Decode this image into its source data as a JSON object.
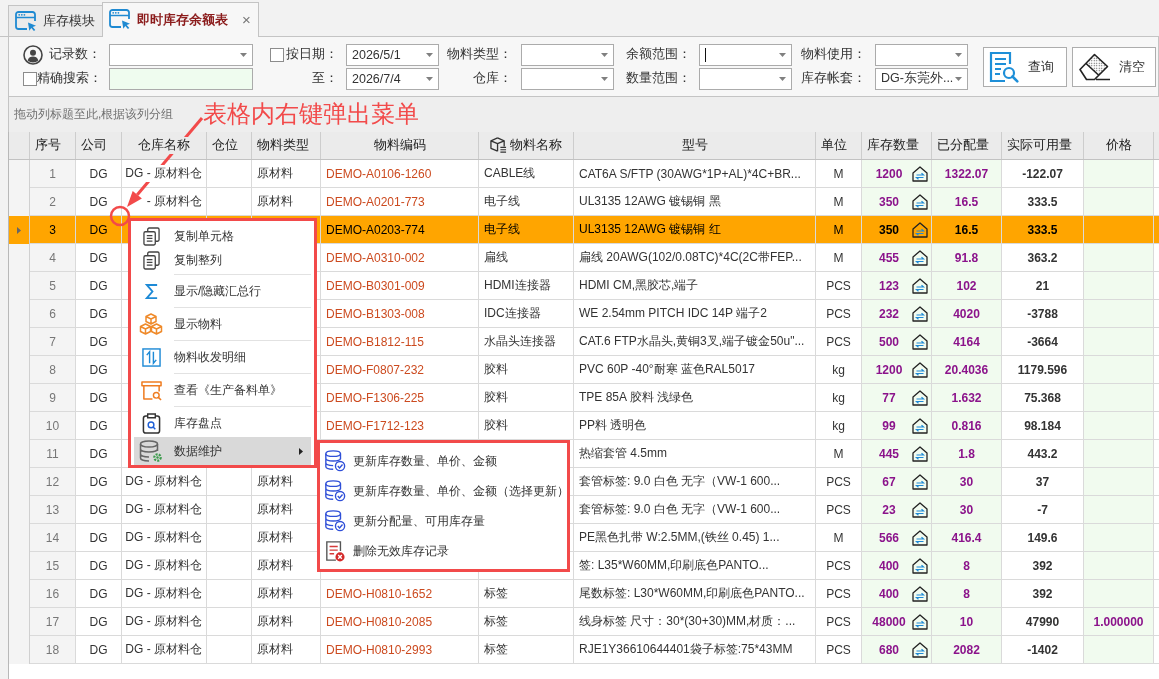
{
  "tabs": [
    {
      "label": "库存模块",
      "selected": false
    },
    {
      "label": "即时库存余额表",
      "selected": true,
      "close": "×"
    }
  ],
  "filters": {
    "record_count": {
      "label": "记录数："
    },
    "exact_search": {
      "label": "精确搜索：",
      "checked": false
    },
    "by_date": {
      "label": "按日期：",
      "checked": false,
      "value": "2026/5/1"
    },
    "date_to": {
      "label": "至：",
      "value": "2026/7/4"
    },
    "material_type": {
      "label": "物料类型："
    },
    "warehouse": {
      "label": "仓库："
    },
    "amount_range": {
      "label": "余额范围：",
      "focused": true
    },
    "quantity_range": {
      "label": "数量范围："
    },
    "material_usage": {
      "label": "物料使用："
    },
    "account_set": {
      "label": "库存帐套：",
      "value": "DG-东莞外..."
    }
  },
  "buttons": [
    {
      "label": "查询"
    },
    {
      "label": "清空"
    }
  ],
  "group_panel": {
    "hint": "拖动列标题至此,根据该列分组"
  },
  "annotation": {
    "text": "表格内右键弹出菜单"
  },
  "table": {
    "columns": [
      {
        "label": "序号"
      },
      {
        "label": "公司"
      },
      {
        "label": "仓库名称"
      },
      {
        "label": "仓位"
      },
      {
        "label": "物料类型"
      },
      {
        "label": "物料编码"
      },
      {
        "label": "物料名称"
      },
      {
        "label": "型号"
      },
      {
        "label": "单位"
      },
      {
        "label": "库存数量"
      },
      {
        "label": "已分配量"
      },
      {
        "label": "实际可用量"
      },
      {
        "label": "价格"
      }
    ],
    "rows": [
      {
        "no": "1",
        "company": "DG",
        "warehouse": "DG - 原材料仓",
        "material_type": "原材料",
        "code": "DEMO-A0106-1260",
        "name": "CABLE线",
        "model": "CAT6A S/FTP (30AWG*1P+AL)*4C+BR...",
        "unit": "M",
        "stock_qty": "1200",
        "allocated": "1322.07",
        "available": "-122.07",
        "selected": false
      },
      {
        "no": "2",
        "company": "DG",
        "warehouse": "- 原材料仓",
        "material_type": "原材料",
        "code": "DEMO-A0201-773",
        "name": "电子线",
        "model": "UL3135 12AWG 镀锡铜 黑",
        "unit": "M",
        "stock_qty": "350",
        "allocated": "16.5",
        "available": "333.5",
        "selected": false
      },
      {
        "no": "3",
        "company": "DG",
        "code": "DEMO-A0203-774",
        "name": "电子线",
        "model": "UL3135 12AWG 镀锡铜 红",
        "unit": "M",
        "stock_qty": "350",
        "allocated": "16.5",
        "available": "333.5",
        "selected": true
      },
      {
        "no": "4",
        "company": "DG",
        "code": "DEMO-A0310-002",
        "name": "扁线",
        "model": "扁线 20AWG(102/0.08TC)*4C(2C带FEP...",
        "unit": "M",
        "stock_qty": "455",
        "allocated": "91.8",
        "available": "363.2",
        "selected": false
      },
      {
        "no": "5",
        "company": "DG",
        "code": "DEMO-B0301-009",
        "name": "HDMI连接器",
        "model": "HDMI CM,黑胶芯,端子",
        "unit": "PCS",
        "stock_qty": "123",
        "allocated": "102",
        "available": "21",
        "selected": false
      },
      {
        "no": "6",
        "company": "DG",
        "code": "DEMO-B1303-008",
        "name": "IDC连接器",
        "model": "WE 2.54mm PITCH IDC 14P 端子2",
        "unit": "PCS",
        "stock_qty": "232",
        "allocated": "4020",
        "available": "-3788",
        "selected": false
      },
      {
        "no": "7",
        "company": "DG",
        "code": "DEMO-B1812-115",
        "name": "水晶头连接器",
        "model": "CAT.6 FTP水晶头,黄铜3叉,端子镀金50u\"...",
        "unit": "PCS",
        "stock_qty": "500",
        "allocated": "4164",
        "available": "-3664",
        "selected": false
      },
      {
        "no": "8",
        "company": "DG",
        "code": "DEMO-F0807-232",
        "name": "胶料",
        "model": "PVC 60P -40°耐寒 蓝色RAL5017",
        "unit": "kg",
        "stock_qty": "1200",
        "allocated": "20.4036",
        "available": "1179.596",
        "selected": false
      },
      {
        "no": "9",
        "company": "DG",
        "code": "DEMO-F1306-225",
        "name": "胶料",
        "model": "TPE 85A 胶料 浅绿色",
        "unit": "kg",
        "stock_qty": "77",
        "allocated": "1.632",
        "available": "75.368",
        "selected": false
      },
      {
        "no": "10",
        "company": "DG",
        "code": "DEMO-F1712-123",
        "name": "胶料",
        "model": "PP料 透明色",
        "unit": "kg",
        "stock_qty": "99",
        "allocated": "0.816",
        "available": "98.184",
        "selected": false
      },
      {
        "no": "11",
        "company": "DG",
        "model": "热缩套管 4.5mm",
        "unit": "M",
        "stock_qty": "445",
        "allocated": "1.8",
        "available": "443.2",
        "selected": false
      },
      {
        "no": "12",
        "company": "DG",
        "warehouse": "DG - 原材料仓",
        "material_type": "原材料",
        "model": "套管标签: 9.0 白色 无字（VW-1 600...",
        "unit": "PCS",
        "stock_qty": "67",
        "allocated": "30",
        "available": "37",
        "selected": false
      },
      {
        "no": "13",
        "company": "DG",
        "warehouse": "DG - 原材料仓",
        "material_type": "原材料",
        "model": "套管标签: 9.0 白色 无字（VW-1 600...",
        "unit": "PCS",
        "stock_qty": "23",
        "allocated": "30",
        "available": "-7",
        "selected": false
      },
      {
        "no": "14",
        "company": "DG",
        "warehouse": "DG - 原材料仓",
        "material_type": "原材料",
        "model": "PE黑色扎带 W:2.5MM,(铁丝 0.45) 1...",
        "unit": "M",
        "stock_qty": "566",
        "allocated": "416.4",
        "available": "149.6",
        "selected": false
      },
      {
        "no": "15",
        "company": "DG",
        "warehouse": "DG - 原材料仓",
        "material_type": "原材料",
        "model": "签: L35*W60MM,印刷底色PANTO...",
        "unit": "PCS",
        "stock_qty": "400",
        "allocated": "8",
        "available": "392",
        "selected": false
      },
      {
        "no": "16",
        "company": "DG",
        "warehouse": "DG - 原材料仓",
        "material_type": "原材料",
        "code": "DEMO-H0810-1652",
        "name": "标签",
        "model": "尾数标签: L30*W60MM,印刷底色PANTO...",
        "unit": "PCS",
        "stock_qty": "400",
        "allocated": "8",
        "available": "392",
        "selected": false
      },
      {
        "no": "17",
        "company": "DG",
        "warehouse": "DG - 原材料仓",
        "material_type": "原材料",
        "code": "DEMO-H0810-2085",
        "name": "标签",
        "model": "线身标签 尺寸：30*(30+30)MM,材质：...",
        "unit": "PCS",
        "stock_qty": "48000",
        "allocated": "10",
        "available": "47990",
        "price": "1.000000",
        "selected": false
      },
      {
        "no": "18",
        "company": "DG",
        "warehouse": "DG - 原材料仓",
        "material_type": "原材料",
        "code": "DEMO-H0810-2993",
        "name": "标签",
        "model": "RJE1Y36610644401袋子标签:75*43MM",
        "unit": "PCS",
        "stock_qty": "680",
        "allocated": "2082",
        "available": "-1402",
        "selected": false
      }
    ]
  },
  "context_menu": {
    "groups": [
      [
        {
          "label": "复制单元格",
          "highlighted": false
        },
        {
          "label": "复制整列",
          "highlighted": false
        }
      ],
      [
        {
          "label": "显示/隐藏汇总行",
          "highlighted": false
        }
      ],
      [
        {
          "label": "显示物料",
          "highlighted": false
        }
      ],
      [
        {
          "label": "物料收发明细",
          "highlighted": false
        }
      ],
      [
        {
          "label": "查看《生产备料单》",
          "highlighted": false
        }
      ],
      [
        {
          "label": "库存盘点",
          "highlighted": false
        },
        {
          "label": "数据维护",
          "highlighted": true,
          "submenu": [
            {
              "label": "更新库存数量、单价、金额"
            },
            {
              "label": "更新库存数量、单价、金额（选择更新）"
            },
            {
              "label": "更新分配量、可用库存量"
            },
            {
              "label": "删除无效库存记录"
            }
          ]
        }
      ]
    ]
  }
}
